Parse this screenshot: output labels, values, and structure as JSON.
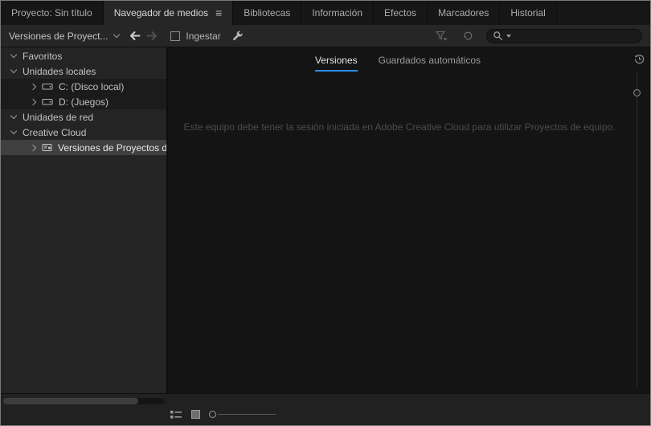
{
  "colors": {
    "accent_blue": "#2d8ceb"
  },
  "icons": {
    "panel_menu": "≡"
  },
  "panel_tabs": [
    {
      "label": "Proyecto: Sin título",
      "active": false
    },
    {
      "label": "Navegador de medios",
      "active": true
    },
    {
      "label": "Bibliotecas",
      "active": false
    },
    {
      "label": "Información",
      "active": false
    },
    {
      "label": "Efectos",
      "active": false
    },
    {
      "label": "Marcadores",
      "active": false
    },
    {
      "label": "Historial",
      "active": false
    }
  ],
  "toolbar": {
    "directory_value": "Versiones de Proyect...",
    "ingest_label": "Ingestar",
    "search_value": ""
  },
  "sidebar": {
    "items": [
      {
        "label": "Favoritos",
        "level": 0,
        "state": "expanded"
      },
      {
        "label": "Unidades locales",
        "level": 0,
        "state": "expanded"
      },
      {
        "label": "C: (Disco local)",
        "level": 1,
        "state": "collapsed",
        "icon": "drive-icon"
      },
      {
        "label": "D: (Juegos)",
        "level": 1,
        "state": "collapsed",
        "icon": "drive-icon"
      },
      {
        "label": "Unidades de red",
        "level": 0,
        "state": "expanded"
      },
      {
        "label": "Creative Cloud",
        "level": 0,
        "state": "expanded"
      },
      {
        "label": "Versiones de Proyectos de",
        "level": 1,
        "state": "collapsed",
        "icon": "team-project-icon",
        "selected": true
      }
    ]
  },
  "content": {
    "tabs": [
      {
        "label": "Versiones",
        "active": true
      },
      {
        "label": "Guardados automáticos",
        "active": false
      }
    ],
    "message": "Este equipo debe tener la sesión iniciada en Adobe Creative Cloud para utilizar Proyectos de equipo."
  }
}
